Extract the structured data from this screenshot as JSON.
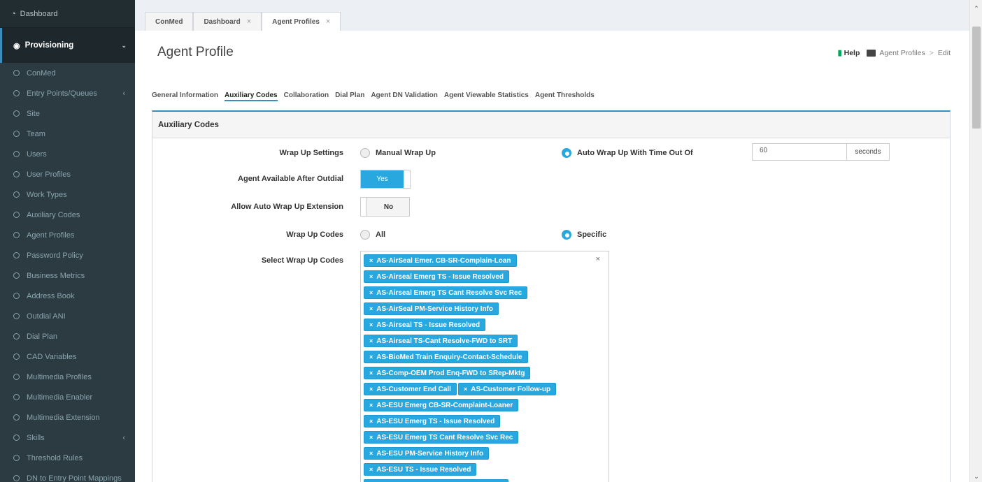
{
  "sidebar": {
    "dashboard": "Dashboard",
    "provisioning": "Provisioning",
    "items": [
      {
        "label": "ConMed",
        "has_children": false
      },
      {
        "label": "Entry Points/Queues",
        "has_children": true
      },
      {
        "label": "Site",
        "has_children": false
      },
      {
        "label": "Team",
        "has_children": false
      },
      {
        "label": "Users",
        "has_children": false
      },
      {
        "label": "User Profiles",
        "has_children": false
      },
      {
        "label": "Work Types",
        "has_children": false
      },
      {
        "label": "Auxiliary Codes",
        "has_children": false
      },
      {
        "label": "Agent Profiles",
        "has_children": false
      },
      {
        "label": "Password Policy",
        "has_children": false
      },
      {
        "label": "Business Metrics",
        "has_children": false
      },
      {
        "label": "Address Book",
        "has_children": false
      },
      {
        "label": "Outdial ANI",
        "has_children": false
      },
      {
        "label": "Dial Plan",
        "has_children": false
      },
      {
        "label": "CAD Variables",
        "has_children": false
      },
      {
        "label": "Multimedia Profiles",
        "has_children": false
      },
      {
        "label": "Multimedia Enabler",
        "has_children": false
      },
      {
        "label": "Multimedia Extension",
        "has_children": false
      },
      {
        "label": "Skills",
        "has_children": true
      },
      {
        "label": "Threshold Rules",
        "has_children": false
      },
      {
        "label": "DN to Entry Point Mappings",
        "has_children": false
      }
    ]
  },
  "tabs": [
    {
      "label": "ConMed",
      "closable": false
    },
    {
      "label": "Dashboard",
      "closable": true
    },
    {
      "label": "Agent Profiles",
      "closable": true,
      "active": true
    }
  ],
  "page": {
    "title": "Agent Profile",
    "help": "Help",
    "breadcrumb": [
      "Agent Profiles",
      "Edit"
    ]
  },
  "subtabs": [
    "General Information",
    "Auxiliary Codes",
    "Collaboration",
    "Dial Plan",
    "Agent DN Validation",
    "Agent Viewable Statistics",
    "Agent Thresholds"
  ],
  "active_subtab": "Auxiliary Codes",
  "panel": {
    "title": "Auxiliary Codes",
    "wrap_up_settings": {
      "label": "Wrap Up Settings",
      "manual": "Manual Wrap Up",
      "auto": "Auto Wrap Up With Time Out Of",
      "selected": "auto",
      "timeout_value": "60",
      "timeout_unit": "seconds"
    },
    "agent_available": {
      "label": "Agent Available After Outdial",
      "value": "Yes"
    },
    "allow_auto_ext": {
      "label": "Allow Auto Wrap Up Extension",
      "value": "No"
    },
    "wrap_up_codes": {
      "label": "Wrap Up Codes",
      "all": "All",
      "specific": "Specific",
      "selected": "specific"
    },
    "select_codes": {
      "label": "Select Wrap Up Codes",
      "clear": "×",
      "chips": [
        [
          "AS-AirSeal Emer. CB-SR-Complain-Loan"
        ],
        [
          "AS-Airseal Emerg TS - Issue Resolved"
        ],
        [
          "AS-Airseal Emerg TS Cant Resolve Svc Rec"
        ],
        [
          "AS-AirSeal PM-Service History Info"
        ],
        [
          "AS-Airseal TS - Issue Resolved"
        ],
        [
          "AS-Airseal TS-Cant Resolve-FWD to SRT"
        ],
        [
          "AS-BioMed Train Enquiry-Contact-Schedule"
        ],
        [
          "AS-Comp-OEM Prod Enq-FWD to SRep-Mktg"
        ],
        [
          "AS-Customer End Call",
          "AS-Customer Follow-up"
        ],
        [
          "AS-ESU Emerg CB-SR-Complaint-Loaner"
        ],
        [
          "AS-ESU Emerg TS - Issue Resolved"
        ],
        [
          "AS-ESU Emerg TS Cant Resolve Svc Rec"
        ],
        [
          "AS-ESU PM-Service History Info",
          "AS-ESU TS - Issue Resolved"
        ],
        [
          "AS-ESU TS-Cant Resolve-FWD to SRT"
        ]
      ]
    }
  },
  "colors": {
    "accent": "#29a8e0",
    "sidebar_bg": "#222d32",
    "help_icon": "#00a65a"
  }
}
